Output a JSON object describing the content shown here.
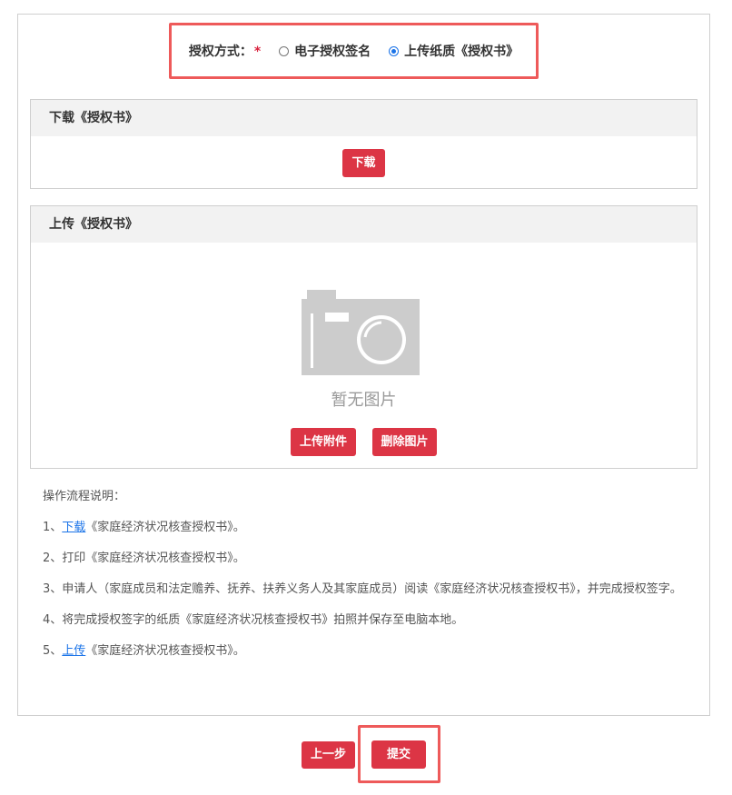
{
  "auth": {
    "label": "授权方式：",
    "required_mark": "*",
    "options": [
      {
        "label": "电子授权签名",
        "selected": false
      },
      {
        "label": "上传纸质《授权书》",
        "selected": true
      }
    ]
  },
  "download_panel": {
    "title": "下载《授权书》",
    "button_label": "下载"
  },
  "upload_panel": {
    "title": "上传《授权书》",
    "placeholder_icon": "camera-icon",
    "no_image_text": "暂无图片",
    "upload_button_label": "上传附件",
    "delete_button_label": "删除图片"
  },
  "instructions": {
    "title": "操作流程说明：",
    "items": [
      {
        "prefix": "1、",
        "link": "下载",
        "text": "《家庭经济状况核查授权书》。"
      },
      {
        "prefix": "2、",
        "text": "打印《家庭经济状况核查授权书》。"
      },
      {
        "prefix": "3、",
        "text": "申请人（家庭成员和法定赡养、抚养、扶养义务人及其家庭成员）阅读《家庭经济状况核查授权书》，并完成授权签字。"
      },
      {
        "prefix": "4、",
        "text": "将完成授权签字的纸质《家庭经济状况核查授权书》拍照并保存至电脑本地。"
      },
      {
        "prefix": "5、",
        "link": "上传",
        "text": "《家庭经济状况核查授权书》。"
      }
    ]
  },
  "footer": {
    "prev_label": "上一步",
    "submit_label": "提交"
  },
  "colors": {
    "primary_button": "#dc3545",
    "highlight_border": "#ee5a5a",
    "link": "#1a73e8"
  }
}
